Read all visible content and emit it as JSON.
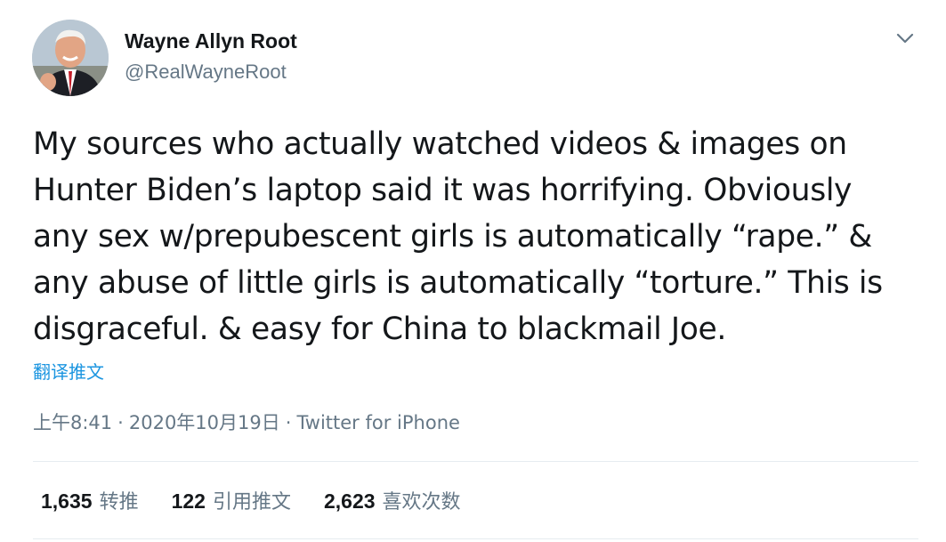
{
  "author": {
    "display_name": "Wayne Allyn Root",
    "handle": "@RealWayneRoot"
  },
  "tweet": {
    "text_lines": [
      "My sources who actually watched videos & images on",
      "Hunter Biden’s laptop said it was horrifying. Obviously",
      "any sex w/prepubescent girls is automatically “rape.” &",
      "any abuse of little girls is automatically “torture.” This is",
      "disgraceful. & easy for China to blackmail Joe."
    ],
    "translate_label": "翻译推文"
  },
  "meta": {
    "time": "上午8:41",
    "separator": "·",
    "date": "2020年10月19日",
    "source": "Twitter for iPhone"
  },
  "stats": {
    "retweets": {
      "count": "1,635",
      "label": "转推"
    },
    "quotes": {
      "count": "122",
      "label": "引用推文"
    },
    "likes": {
      "count": "2,623",
      "label": "喜欢次数"
    }
  },
  "icons": {
    "menu": "chevron-down-icon",
    "avatar": "profile-photo"
  }
}
